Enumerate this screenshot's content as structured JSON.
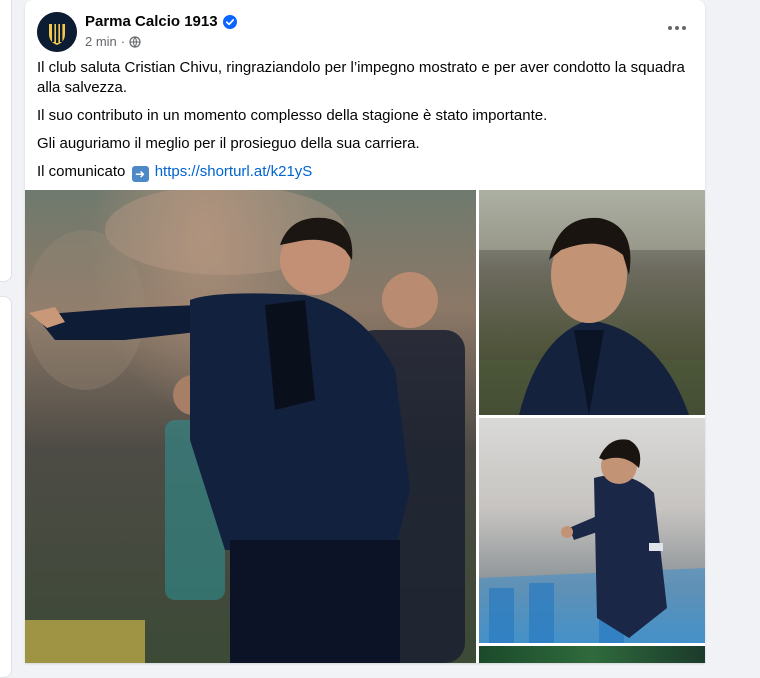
{
  "post": {
    "page_name": "Parma Calcio 1913",
    "time": "2 min",
    "separator": "·",
    "paragraphs": [
      "Il club saluta Cristian Chivu, ringraziandolo per l’impegno mostrato e per aver condotto la squadra alla salvezza.",
      "Il suo contributo in un momento complesso della stagione è stato importante.",
      "Gli auguriamo il meglio per il prosieguo della sua carriera."
    ],
    "communique_label": "Il comunicato",
    "link_text": "https://shorturl.at/k21yS"
  },
  "icons": {
    "verified": "verified-badge-icon",
    "audience": "globe-icon",
    "options": "more-options-icon",
    "arrow": "right-arrow-emoji"
  },
  "colors": {
    "verified_blue": "#0866ff",
    "link": "#0064d1",
    "meta_gray": "#65676b",
    "crest_yellow": "#f2c94c"
  }
}
